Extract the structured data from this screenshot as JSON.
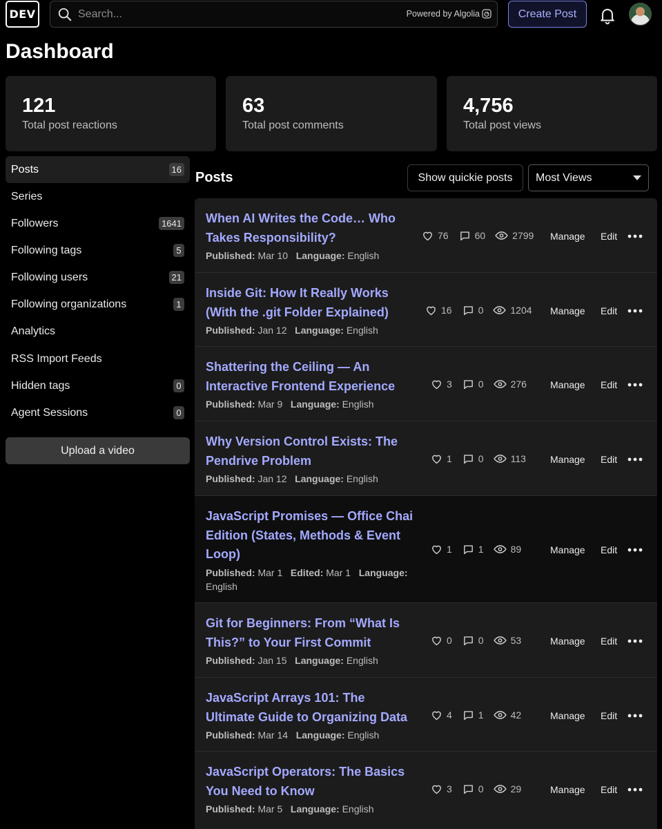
{
  "header": {
    "logo": "DEV",
    "search_placeholder": "Search...",
    "powered_by": "Powered by Algolia",
    "create_post": "Create Post"
  },
  "page_title": "Dashboard",
  "stats": [
    {
      "value": "121",
      "label": "Total post reactions"
    },
    {
      "value": "63",
      "label": "Total post comments"
    },
    {
      "value": "4,756",
      "label": "Total post views"
    }
  ],
  "sidebar": {
    "items": [
      {
        "label": "Posts",
        "count": "16"
      },
      {
        "label": "Series",
        "count": ""
      },
      {
        "label": "Followers",
        "count": "1641"
      },
      {
        "label": "Following tags",
        "count": "5"
      },
      {
        "label": "Following users",
        "count": "21"
      },
      {
        "label": "Following organizations",
        "count": "1"
      },
      {
        "label": "Analytics",
        "count": ""
      },
      {
        "label": "RSS Import Feeds",
        "count": ""
      },
      {
        "label": "Hidden tags",
        "count": "0"
      },
      {
        "label": "Agent Sessions",
        "count": "0"
      }
    ],
    "upload_video": "Upload a video"
  },
  "posts_section": {
    "heading": "Posts",
    "quickie_button": "Show quickie posts",
    "sort_selected": "Most Views",
    "manage_label": "Manage",
    "edit_label": "Edit",
    "published_label": "Published:",
    "edited_label": "Edited:",
    "language_label": "Language:"
  },
  "posts": [
    {
      "title": "When AI Writes the Code… Who Takes Responsibility?",
      "published": "Mar 10",
      "edited": "",
      "language": "English",
      "reactions": "76",
      "comments": "60",
      "views": "2799"
    },
    {
      "title": "Inside Git: How It Really Works (With the .git Folder Explained)",
      "published": "Jan 12",
      "edited": "",
      "language": "English",
      "reactions": "16",
      "comments": "0",
      "views": "1204"
    },
    {
      "title": "Shattering the Ceiling — An Interactive Frontend Experience",
      "published": "Mar 9",
      "edited": "",
      "language": "English",
      "reactions": "3",
      "comments": "0",
      "views": "276"
    },
    {
      "title": "Why Version Control Exists: The Pendrive Problem",
      "published": "Jan 12",
      "edited": "",
      "language": "English",
      "reactions": "1",
      "comments": "0",
      "views": "113"
    },
    {
      "title": "JavaScript Promises — Office Chai Edition (States, Methods & Event Loop)",
      "published": "Mar 1",
      "edited": "Mar 1",
      "language": "English",
      "reactions": "1",
      "comments": "1",
      "views": "89"
    },
    {
      "title": "Git for Beginners: From “What Is This?” to Your First Commit",
      "published": "Jan 15",
      "edited": "",
      "language": "English",
      "reactions": "0",
      "comments": "0",
      "views": "53"
    },
    {
      "title": "JavaScript Arrays 101: The Ultimate Guide to Organizing Data",
      "published": "Mar 14",
      "edited": "",
      "language": "English",
      "reactions": "4",
      "comments": "1",
      "views": "42"
    },
    {
      "title": "JavaScript Operators: The Basics You Need to Know",
      "published": "Mar 5",
      "edited": "",
      "language": "English",
      "reactions": "3",
      "comments": "0",
      "views": "29"
    }
  ]
}
